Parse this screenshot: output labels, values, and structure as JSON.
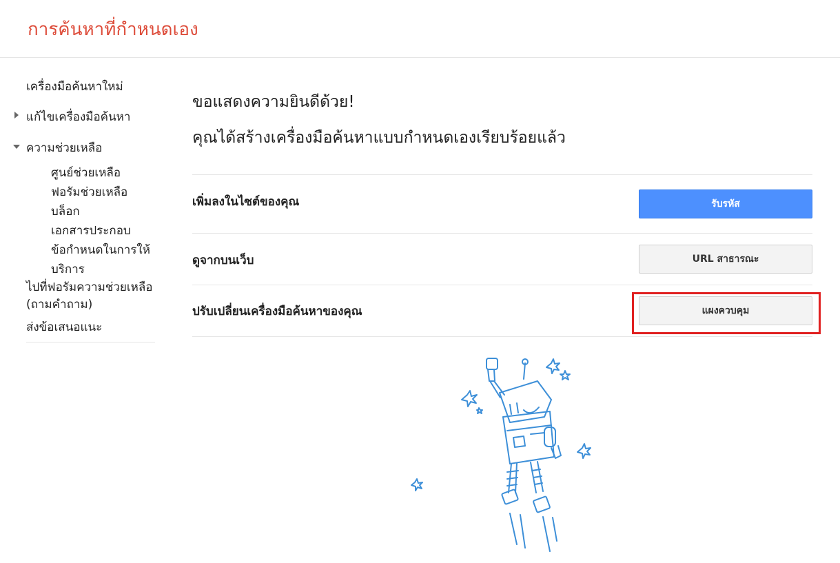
{
  "header": {
    "title": "การค้นหาที่กำหนดเอง"
  },
  "sidebar": {
    "new_engine": "เครื่องมือค้นหาใหม่",
    "edit_engine": "แก้ไขเครื่องมือค้นหา",
    "help": "ความช่วยเหลือ",
    "help_items": [
      "ศูนย์ช่วยเหลือ",
      "ฟอรัมช่วยเหลือ",
      "บล็อก",
      "เอกสารประกอบ",
      "ข้อกำหนดในการให้",
      "บริการ"
    ],
    "forum_link_line1": "ไปที่ฟอรัมความช่วยเหลือ",
    "forum_link_line2": "(ถามคำถาม)",
    "feedback": "ส่งข้อเสนอแนะ"
  },
  "main": {
    "congrats": "ขอแสดงความยินดีด้วย!",
    "created": "คุณได้สร้างเครื่องมือค้นหาแบบกำหนดเองเรียบร้อยแล้ว",
    "rows": [
      {
        "label": "เพิ่มลงในไซต์ของคุณ",
        "button": "รับรหัส"
      },
      {
        "label": "ดูจากบนเว็บ",
        "button": "URL สาธารณะ"
      },
      {
        "label": "ปรับเปลี่ยนเครื่องมือค้นหาของคุณ",
        "button": "แผงควบคุม"
      }
    ]
  },
  "colors": {
    "title_red": "#dd4b39",
    "primary_blue": "#4d90fe",
    "highlight_red": "#e02020",
    "robot_blue": "#3d8fd8"
  },
  "icons": {
    "collapsed_arrow": "triangle-right-icon",
    "expanded_arrow": "triangle-down-icon",
    "illustration": "robot-illustration"
  }
}
